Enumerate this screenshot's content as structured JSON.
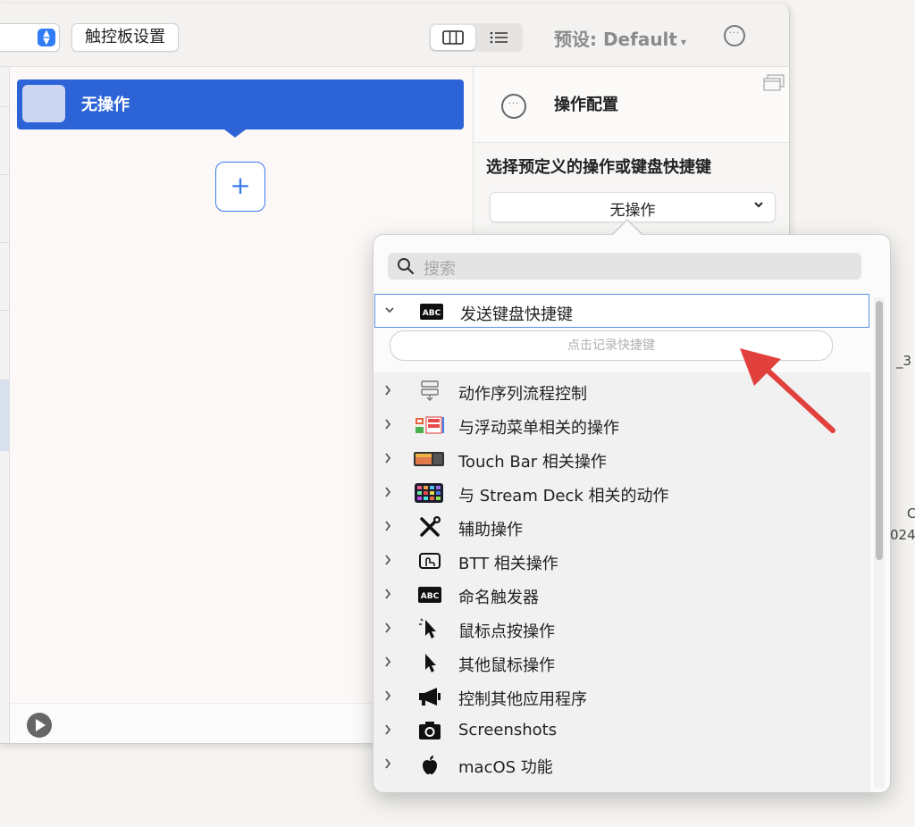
{
  "toolbar": {
    "trackpad_settings_label": "触控板设置",
    "preset_label": "预设: Default",
    "preset_caret": "▾",
    "more_glyph": "···"
  },
  "trigger": {
    "label": "无操作",
    "add_glyph": "+"
  },
  "config_panel": {
    "title": "操作配置",
    "subtitle": "选择预定义的操作或键盘快捷键",
    "selected_action": "无操作",
    "chevron": "⌄"
  },
  "popover": {
    "search_placeholder": "搜索",
    "expanded_item": {
      "label": "发送键盘快捷键",
      "icon": "abc-keyboard-icon",
      "record_placeholder": "点击记录快捷键"
    },
    "items": [
      {
        "label": "动作序列流程控制",
        "icon": "flow-control-icon"
      },
      {
        "label": "与浮动菜单相关的操作",
        "icon": "floating-menu-icon"
      },
      {
        "label": "Touch Bar 相关操作",
        "icon": "touch-bar-icon"
      },
      {
        "label": "与 Stream Deck 相关的动作",
        "icon": "stream-deck-icon"
      },
      {
        "label": "辅助操作",
        "icon": "tools-icon"
      },
      {
        "label": "BTT 相关操作",
        "icon": "btt-icon"
      },
      {
        "label": "命名触发器",
        "icon": "abc-keyboard-icon"
      },
      {
        "label": "鼠标点按操作",
        "icon": "mouse-click-icon"
      },
      {
        "label": "其他鼠标操作",
        "icon": "mouse-pointer-icon"
      },
      {
        "label": "控制其他应用程序",
        "icon": "megaphone-icon"
      },
      {
        "label": "Screenshots",
        "icon": "camera-icon"
      },
      {
        "label": "macOS 功能",
        "icon": "apple-icon"
      }
    ]
  },
  "colors": {
    "accent": "#2c63d6",
    "highlight_border": "#5b8fe6",
    "annotation_arrow": "#e2403c"
  },
  "desktop_hints": [
    "_3",
    "C",
    "024"
  ]
}
